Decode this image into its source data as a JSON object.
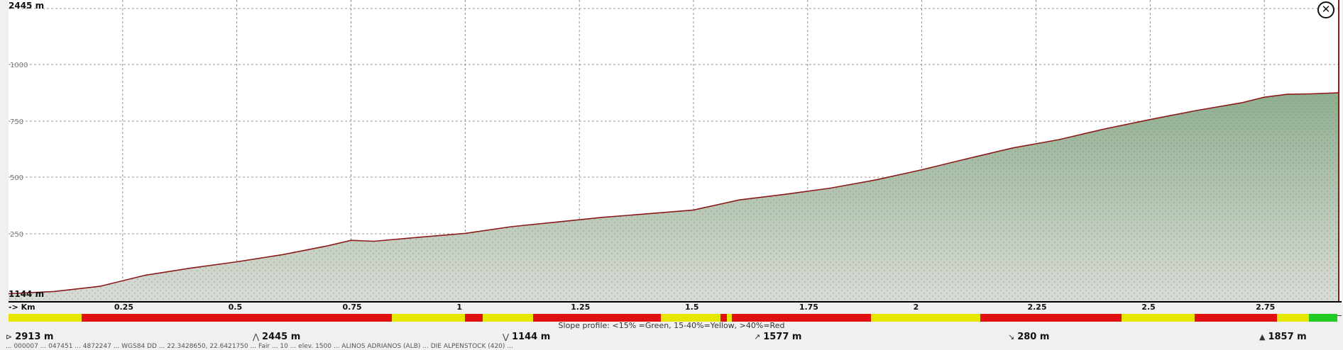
{
  "chart_data": {
    "type": "area",
    "title": "",
    "xlabel": "-> Km",
    "ylabel": "",
    "y_max_label": "2445 m",
    "y_min_label": "1144 m",
    "ylim": [
      1144,
      2445
    ],
    "xlim": [
      0,
      2.913
    ],
    "y_ticks": [
      "1000",
      "750",
      "500",
      "250"
    ],
    "x_ticks": [
      "0.25",
      "0.5",
      "0.75",
      "1",
      "1.25",
      "1.5",
      "1.75",
      "2",
      "2.25",
      "2.5",
      "2.75"
    ],
    "x": [
      0,
      0.1,
      0.2,
      0.3,
      0.4,
      0.5,
      0.6,
      0.7,
      0.75,
      0.8,
      0.9,
      1.0,
      1.1,
      1.2,
      1.3,
      1.4,
      1.5,
      1.6,
      1.7,
      1.8,
      1.9,
      2.0,
      2.1,
      2.2,
      2.3,
      2.4,
      2.5,
      2.6,
      2.7,
      2.75,
      2.8,
      2.85,
      2.913
    ],
    "series": [
      {
        "values": [
          1155,
          1165,
          1188,
          1238,
          1270,
          1298,
          1330,
          1370,
          1394,
          1390,
          1408,
          1425,
          1455,
          1476,
          1497,
          1513,
          1530,
          1575,
          1600,
          1628,
          1665,
          1710,
          1760,
          1808,
          1845,
          1893,
          1935,
          1975,
          2010,
          2035,
          2048,
          2050,
          2055
        ]
      }
    ],
    "area_color": "#8fae8f",
    "line_color": "#8b1a1a",
    "grid": true
  },
  "slope_profile": {
    "legend": "Slope profile: <15% =Green, 15-40%=Yellow, >40%=Red",
    "colors": {
      "green": "#22cc22",
      "yellow": "#e6e600",
      "red": "#e01010"
    },
    "segments": [
      {
        "from": 0.0,
        "to": 0.16,
        "color": "yellow"
      },
      {
        "from": 0.16,
        "to": 0.84,
        "color": "red"
      },
      {
        "from": 0.84,
        "to": 1.0,
        "color": "yellow"
      },
      {
        "from": 1.0,
        "to": 1.04,
        "color": "red"
      },
      {
        "from": 1.04,
        "to": 1.15,
        "color": "yellow"
      },
      {
        "from": 1.15,
        "to": 1.43,
        "color": "red"
      },
      {
        "from": 1.43,
        "to": 1.56,
        "color": "yellow"
      },
      {
        "from": 1.56,
        "to": 1.575,
        "color": "red"
      },
      {
        "from": 1.575,
        "to": 1.585,
        "color": "yellow"
      },
      {
        "from": 1.585,
        "to": 1.89,
        "color": "red"
      },
      {
        "from": 1.89,
        "to": 2.13,
        "color": "yellow"
      },
      {
        "from": 2.13,
        "to": 2.44,
        "color": "red"
      },
      {
        "from": 2.44,
        "to": 2.6,
        "color": "yellow"
      },
      {
        "from": 2.6,
        "to": 2.78,
        "color": "red"
      },
      {
        "from": 2.78,
        "to": 2.85,
        "color": "yellow"
      },
      {
        "from": 2.85,
        "to": 2.913,
        "color": "green"
      }
    ]
  },
  "stats": {
    "distance": "2913 m",
    "max_alt": "2445 m",
    "min_alt": "1144 m",
    "ascent": "1577 m",
    "descent": "280 m",
    "time_alt": "1857 m"
  },
  "icons": {
    "close": "close-circle-icon",
    "distance": "distance-icon",
    "max": "peak-up-icon",
    "min": "valley-down-icon",
    "ascent": "ascent-icon",
    "descent": "descent-icon",
    "last": "summit-icon"
  },
  "status_line": "... 000007 ... 047451 ... 4872247 ... WGS84 DD ... 22.3428650, 22.6421750 ... Fair ... 10 ... elev. 1500 ... ALINOS ADRIANOS (ALB) ... DIE ALPENSTOCK (420) ..."
}
